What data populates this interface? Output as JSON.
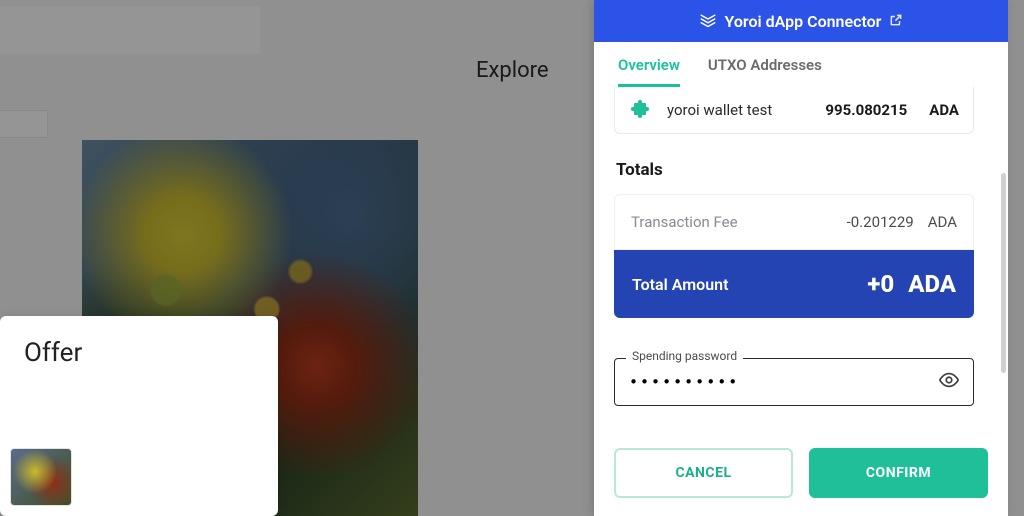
{
  "background": {
    "explore_label": "Explore",
    "offer_title": "Offer"
  },
  "connector": {
    "title": "Yoroi dApp Connector",
    "tabs": {
      "overview": "Overview",
      "utxo": "UTXO Addresses"
    },
    "wallet": {
      "name": "yoroi wallet test",
      "balance": "995.080215",
      "currency": "ADA"
    },
    "totals": {
      "title": "Totals",
      "fee_label": "Transaction Fee",
      "fee_value": "-0.201229",
      "fee_currency": "ADA",
      "total_label": "Total Amount",
      "total_value": "+0",
      "total_currency": "ADA"
    },
    "password": {
      "label": "Spending password",
      "value": "••••••••••"
    },
    "actions": {
      "cancel": "CANCEL",
      "confirm": "CONFIRM"
    }
  }
}
